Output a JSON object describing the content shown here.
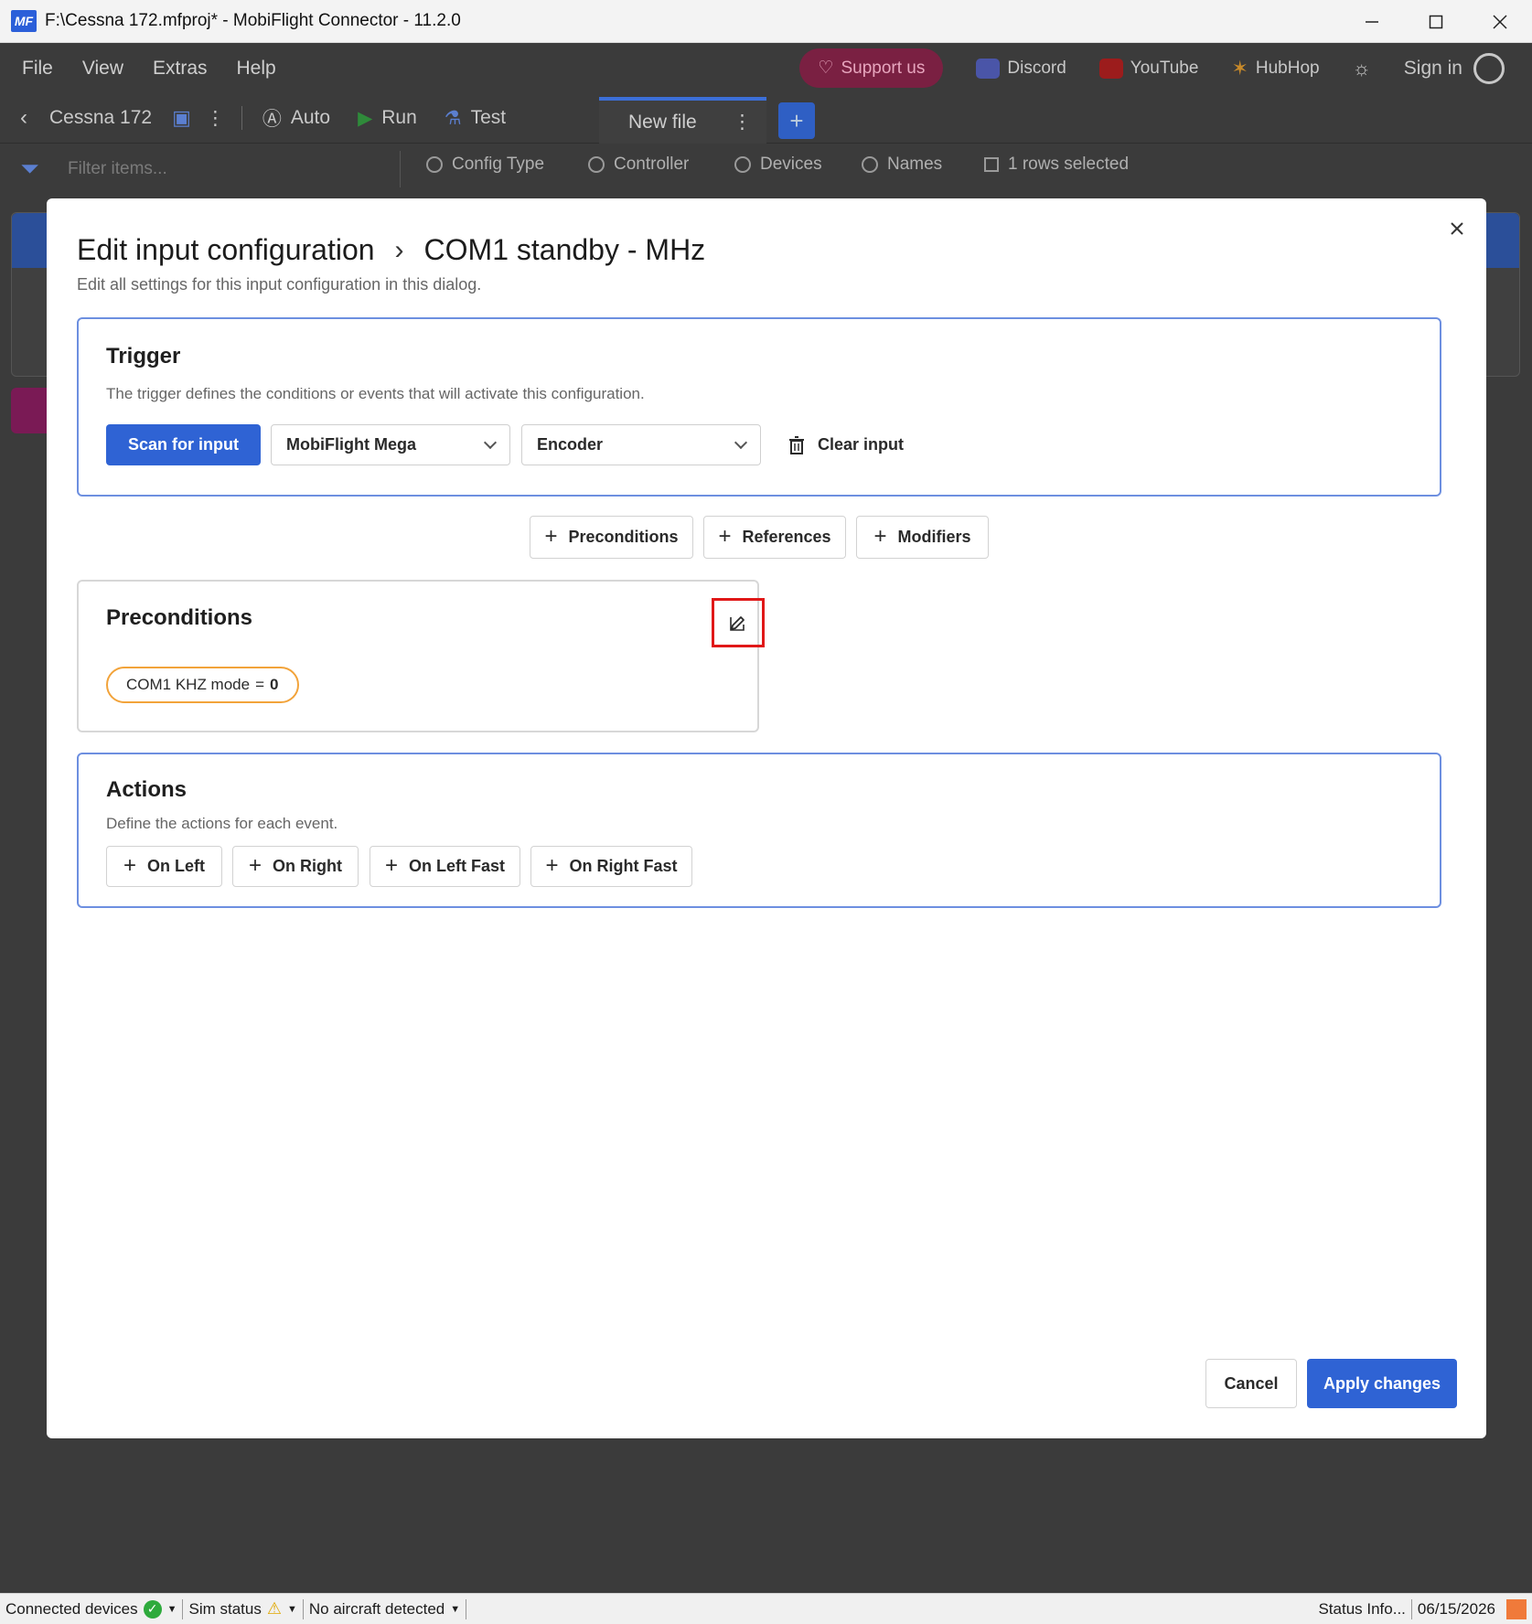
{
  "window": {
    "title": "F:\\Cessna 172.mfproj* - MobiFlight Connector - 11.2.0",
    "logo_text": "MF"
  },
  "menubar": {
    "items": [
      "File",
      "View",
      "Extras",
      "Help"
    ],
    "support": "Support us",
    "discord": "Discord",
    "youtube": "YouTube",
    "hubhop": "HubHop",
    "signin": "Sign in"
  },
  "toolbar": {
    "project": "Cessna 172",
    "auto": "Auto",
    "run": "Run",
    "test": "Test",
    "tab_label": "New file"
  },
  "filterbar": {
    "placeholder": "Filter items...",
    "config_type": "Config Type",
    "controller": "Controller",
    "devices": "Devices",
    "names": "Names",
    "rows_selected": "1 rows selected"
  },
  "dialog": {
    "title": "Edit input configuration",
    "breadcrumb": "COM1 standby - MHz",
    "subtitle": "Edit all settings for this input configuration in this dialog.",
    "trigger": {
      "heading": "Trigger",
      "description": "The trigger defines the conditions or events that will activate this configuration.",
      "scan_button": "Scan for input",
      "device_select": "MobiFlight Mega",
      "input_type_select": "Encoder",
      "clear_input": "Clear input"
    },
    "add_buttons": [
      "Preconditions",
      "References",
      "Modifiers"
    ],
    "preconditions": {
      "heading": "Preconditions",
      "condition_name": "COM1 KHZ mode",
      "condition_op": "=",
      "condition_value": "0"
    },
    "actions": {
      "heading": "Actions",
      "description": "Define the actions for each event.",
      "buttons": [
        "On Left",
        "On Right",
        "On Left Fast",
        "On Right Fast"
      ]
    },
    "cancel": "Cancel",
    "apply": "Apply changes"
  },
  "statusbar": {
    "connected_devices": "Connected devices",
    "sim_status": "Sim status",
    "aircraft": "No aircraft detected",
    "status_info": "Status Info...",
    "date": "06/15/2026"
  },
  "colors": {
    "primary": "#2f63d4",
    "card_border": "#6d8fe0",
    "precondition_border": "#f2a33a",
    "highlight": "#e01818"
  }
}
